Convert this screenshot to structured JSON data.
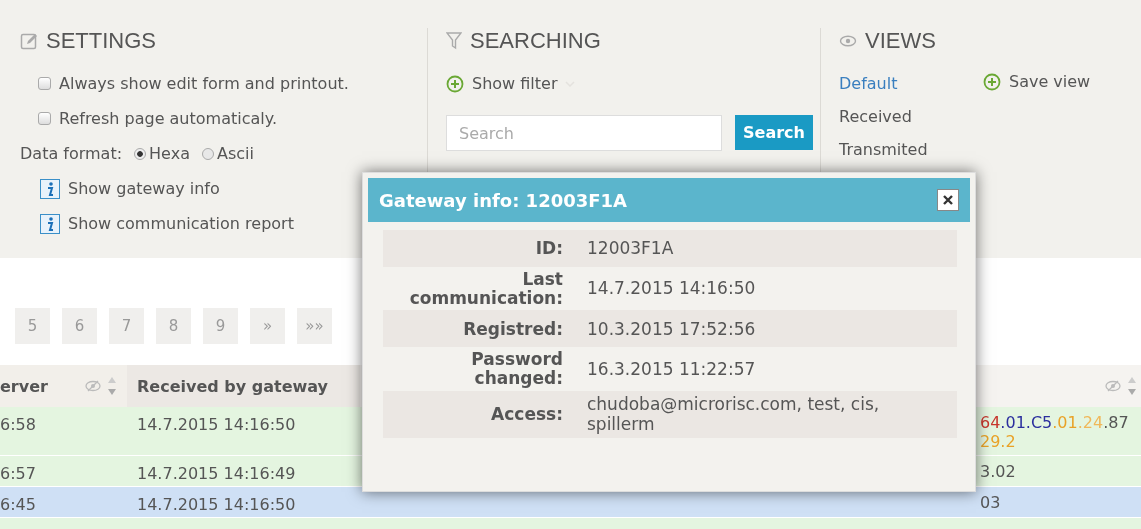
{
  "settings": {
    "title": "SETTINGS",
    "options": [
      {
        "label": "Always show edit form and printout.",
        "checked": false
      },
      {
        "label": "Refresh page automaticaly.",
        "checked": false
      }
    ],
    "data_format": {
      "label": "Data format:",
      "choices": [
        {
          "label": "Hexa",
          "selected": true
        },
        {
          "label": "Ascii",
          "selected": false
        }
      ]
    },
    "links": [
      "Show gateway info",
      "Show communication report"
    ]
  },
  "searching": {
    "title": "SEARCHING",
    "show_filter": "Show filter",
    "search": {
      "placeholder": "Search"
    },
    "search_button": "Search"
  },
  "views": {
    "title": "VIEWS",
    "items": [
      {
        "label": "Default",
        "selected": true
      },
      {
        "label": "Received",
        "selected": false
      },
      {
        "label": "Transmited",
        "selected": false
      }
    ],
    "save_view": "Save view"
  },
  "pagination": [
    "5",
    "6",
    "7",
    "8",
    "9",
    "»",
    "»»"
  ],
  "table": {
    "columns": [
      "erver",
      "Received by gateway"
    ],
    "rows": [
      {
        "highlighted": false,
        "cells": [
          "6:58",
          "14.7.2015 14:16:50"
        ],
        "data": [
          [
            {
              "text": "64",
              "color": "#c8372d"
            },
            {
              "text": ".01.C5",
              "color": "#2b2f9e"
            },
            {
              "text": ".01",
              "color": "#e9a227"
            },
            {
              "text": ".24",
              "color": "#f0b85a"
            },
            {
              "text": ".87",
              "color": "#555555"
            }
          ],
          [
            {
              "text": "29.2",
              "color": "#e9a227"
            }
          ]
        ]
      },
      {
        "highlighted": false,
        "cells": [
          "6:57",
          "14.7.2015 14:16:49"
        ],
        "data": [
          [
            {
              "text": "3.02",
              "color": "#555555"
            }
          ]
        ]
      },
      {
        "highlighted": true,
        "cells": [
          "6:45",
          "14.7.2015 14:16:50"
        ],
        "data": [
          [
            {
              "text": "03",
              "color": "#555555"
            }
          ]
        ]
      },
      {
        "highlighted": false,
        "cells": [],
        "data": []
      }
    ]
  },
  "dialog": {
    "title": "Gateway info: 12003F1A",
    "fields": [
      {
        "label": "ID:",
        "value": "12003F1A"
      },
      {
        "label": "Last communication:",
        "value": "14.7.2015 14:16:50"
      },
      {
        "label": "Registred:",
        "value": "10.3.2015 17:52:56"
      },
      {
        "label": "Password changed:",
        "value": "16.3.2015 11:22:57"
      },
      {
        "label": "Access:",
        "value": "chudoba@microrisc.com, test, cis, spillerm"
      }
    ]
  }
}
